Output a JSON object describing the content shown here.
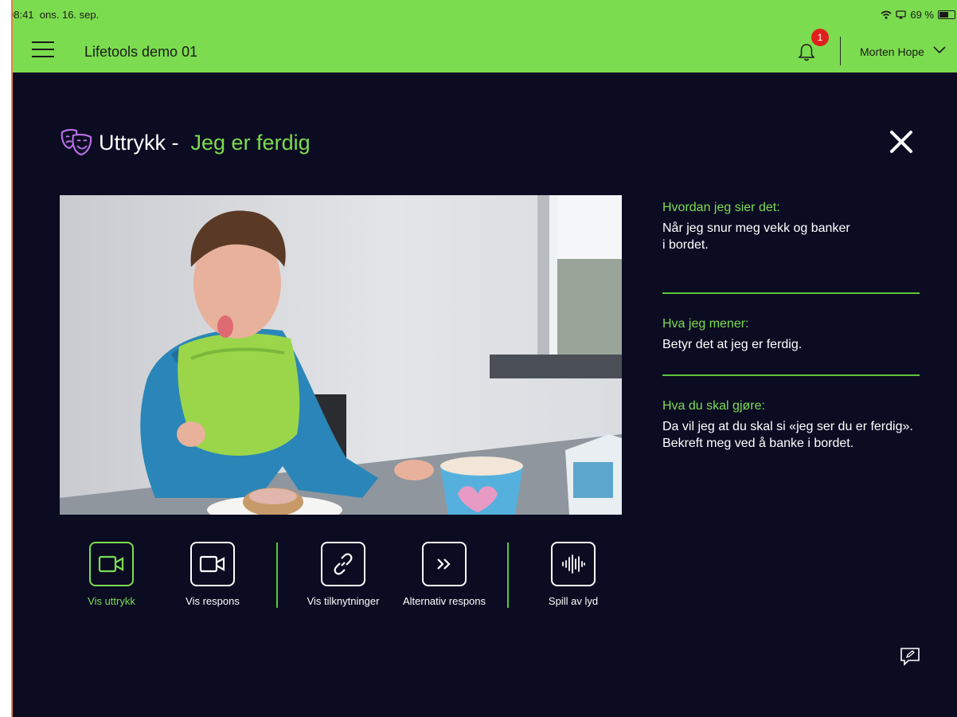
{
  "status": {
    "time": "08:41",
    "date": "ons. 16. sep.",
    "battery": "69 %",
    "battery_level": 0.69
  },
  "app": {
    "title": "Lifetools demo 01",
    "notifications": "1",
    "user": "Morten Hope"
  },
  "colors": {
    "accent": "#7cdc4f",
    "background": "#0b0c22",
    "badge": "#e0201e",
    "mask_icon": "#b46ee0"
  },
  "heading": {
    "prefix": "Uttrykk -",
    "title": "Jeg er ferdig",
    "icon": "theater-masks-icon"
  },
  "info": {
    "how_label": "Hvordan jeg sier det:",
    "how_line1": "Når jeg snur meg vekk og banker",
    "how_line2": "i bordet.",
    "mean_label": "Hva jeg mener:",
    "mean_text": "Betyr det at jeg er ferdig.",
    "do_label": "Hva du skal gjøre:",
    "do_line1": "Da vil jeg at du skal si «jeg ser du er ferdig».",
    "do_line2": "Bekreft meg ved å banke i bordet."
  },
  "actions": [
    {
      "label": "Vis uttrykk",
      "icon": "video-camera-icon",
      "active": true
    },
    {
      "label": "Vis respons",
      "icon": "video-camera-icon",
      "active": false
    },
    {
      "label": "Vis tilknytninger",
      "icon": "link-icon",
      "active": false
    },
    {
      "label": "Alternativ respons",
      "icon": "double-chevron-right-icon",
      "active": false
    },
    {
      "label": "Spill av lyd",
      "icon": "sound-wave-icon",
      "active": false
    }
  ]
}
